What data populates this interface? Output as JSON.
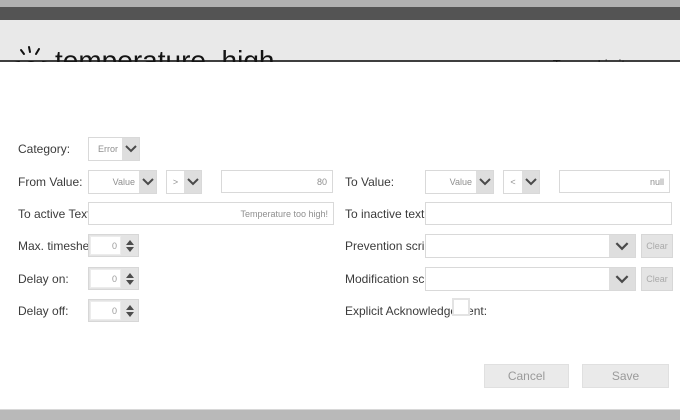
{
  "header": {
    "icon": "alarm-siren-icon",
    "title": "temperature_high",
    "type_label": "Type:",
    "type_value": "Limit"
  },
  "form": {
    "category": {
      "label": "Category:",
      "value": "Error"
    },
    "from_value": {
      "label": "From Value:",
      "source": "Value",
      "comparator": ">",
      "value": "80"
    },
    "to_value": {
      "label": "To Value:",
      "source": "Value",
      "comparator": "<",
      "value": "null"
    },
    "to_active_text": {
      "label": "To active Text:",
      "value": "Temperature too high!"
    },
    "to_inactive_text": {
      "label": "To inactive text:",
      "value": ""
    },
    "max_timeshelve": {
      "label": "Max. timeshelve:",
      "value": "0"
    },
    "delay_on": {
      "label": "Delay on:",
      "value": "0"
    },
    "delay_off": {
      "label": "Delay off:",
      "value": "0"
    },
    "prevention_script": {
      "label": "Prevention script:",
      "value": "",
      "clear_label": "Clear"
    },
    "modification_script": {
      "label": "Modification script:",
      "value": "",
      "clear_label": "Clear"
    },
    "explicit_acknowledgement": {
      "label": "Explicit Acknowledgement:",
      "checked": false
    }
  },
  "actions": {
    "cancel_label": "Cancel",
    "save_label": "Save"
  },
  "colors": {
    "top_bar": "#b1b1b1",
    "dark_bar": "#545454",
    "header_bg": "#e9e9e9",
    "form_bg": "#ffffff",
    "control_gray": "#dedede",
    "bottom_bar": "#b9b9b9"
  }
}
